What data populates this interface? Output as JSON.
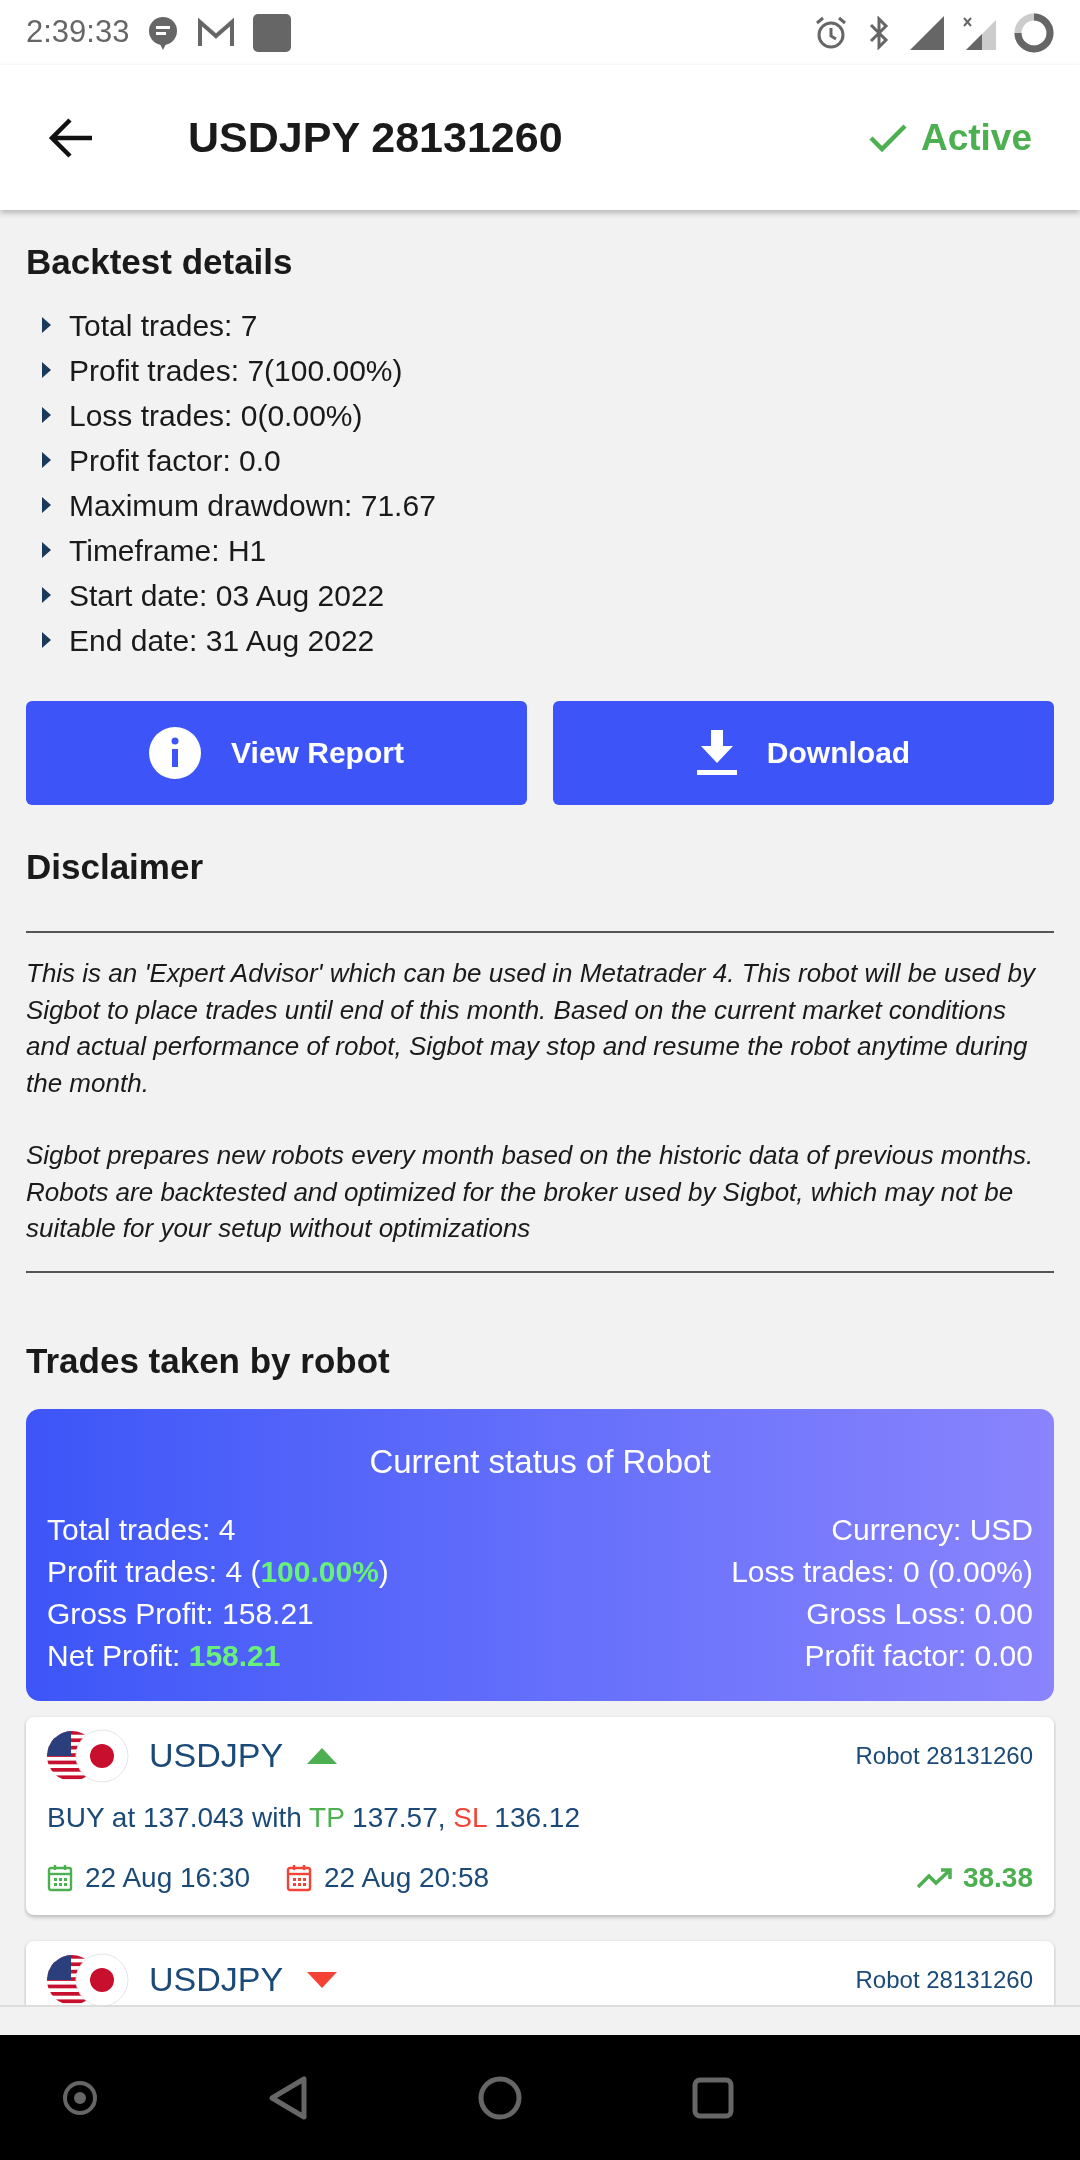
{
  "status_bar": {
    "time": "2:39:33"
  },
  "header": {
    "title": "USDJPY 28131260",
    "status": "Active",
    "active": true
  },
  "backtest": {
    "title": "Backtest details",
    "items": [
      "Total trades: 7",
      "Profit trades: 7(100.00%)",
      "Loss trades: 0(0.00%)",
      "Profit factor: 0.0",
      "Maximum drawdown: 71.67",
      "Timeframe: H1",
      "Start date: 03 Aug 2022",
      "End date: 31 Aug 2022"
    ]
  },
  "buttons": [
    {
      "label": "View Report",
      "kind": "info"
    },
    {
      "label": "Download",
      "kind": "download"
    }
  ],
  "disclaimer": {
    "title": "Disclaimer",
    "paragraphs": [
      "This is an 'Expert Advisor' which can be used in Metatrader 4. This robot will be used by Sigbot to place trades until end of this month. Based on the current market conditions and actual performance of robot, Sigbot may stop and resume the robot anytime during the month.",
      "Sigbot prepares new robots every month based on the historic data of previous months. Robots are backtested and optimized for the broker used by Sigbot, which may not be suitable for your setup without optimizations"
    ]
  },
  "trades": {
    "title": "Trades taken by robot",
    "status_card": {
      "title": "Current status of Robot",
      "left": [
        "Total trades: 4",
        "Profit trades: 4 (**100.00%**)",
        "Gross Profit: 158.21",
        "Net Profit: **158.21**"
      ],
      "right": [
        "Currency: USD",
        "Loss trades: 0 (0.00%)",
        "Gross Loss: 0.00",
        "Profit factor: 0.00"
      ]
    },
    "items": [
      {
        "pair": "USDJPY",
        "rising": true,
        "robot": "Robot 28131260",
        "entry": "BUY at 137.043 with",
        "tp_label": "TP",
        "tp": "137.57,",
        "sl_label": "SL",
        "sl": "136.12",
        "open_time": "22 Aug 16:30",
        "close_time": "22 Aug 20:58",
        "profit": "38.38"
      },
      {
        "pair": "USDJPY",
        "rising": false,
        "robot": "Robot 28131260"
      }
    ]
  }
}
